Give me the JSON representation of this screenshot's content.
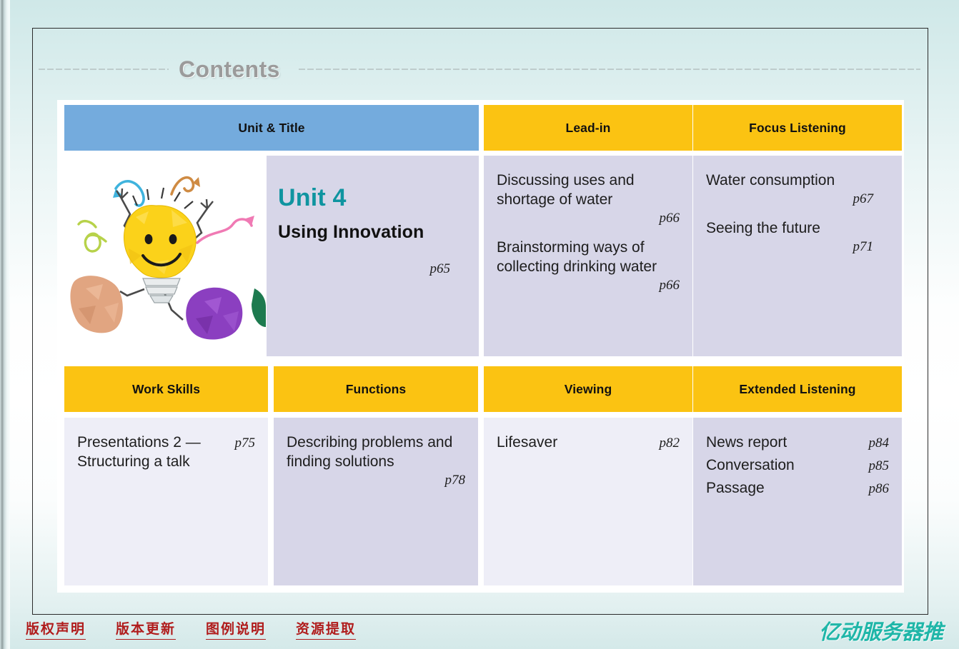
{
  "slide": {
    "title": "Contents",
    "colors": {
      "header_blue": "#74abdd",
      "header_gold": "#fbc312",
      "cell_lavender": "#d7d6e8",
      "cell_lavender_light": "#eeeef7",
      "unit_teal": "#0f94a0",
      "title_gray": "#9b9b9b",
      "footer_link_red": "#b01c1c",
      "watermark_teal": "#1fb6a8"
    }
  },
  "grid": {
    "headers": {
      "unit_title": "Unit & Title",
      "lead_in": "Lead-in",
      "focus_listening": "Focus Listening",
      "work_skills": "Work Skills",
      "functions": "Functions",
      "viewing": "Viewing",
      "extended_listening": "Extended Listening"
    },
    "unit": {
      "number": "Unit 4",
      "name": "Using Innovation",
      "page": "p65",
      "illustration": "crumpled-paper-lightbulb-character-illustration"
    },
    "lead_in": [
      {
        "text": "Discussing uses and shortage of water",
        "page": "p66"
      },
      {
        "text": "Brainstorming ways of collecting drinking water",
        "page": "p66"
      }
    ],
    "focus_listening": [
      {
        "text": "Water consumption",
        "page": "p67"
      },
      {
        "text": "Seeing the future",
        "page": "p71"
      }
    ],
    "work_skills": [
      {
        "text": "Presentations 2 — Structuring a talk",
        "page": "p75"
      }
    ],
    "functions": [
      {
        "text": "Describing problems and finding solutions",
        "page": "p78"
      }
    ],
    "viewing": [
      {
        "text": "Lifesaver",
        "page": "p82"
      }
    ],
    "extended_listening": [
      {
        "text": "News report",
        "page": "p84"
      },
      {
        "text": "Conversation",
        "page": "p85"
      },
      {
        "text": "Passage",
        "page": "p86"
      }
    ]
  },
  "footer": {
    "links": [
      "版权声明",
      "版本更新",
      "图例说明",
      "资源提取"
    ],
    "watermark": "亿动服务器推"
  }
}
